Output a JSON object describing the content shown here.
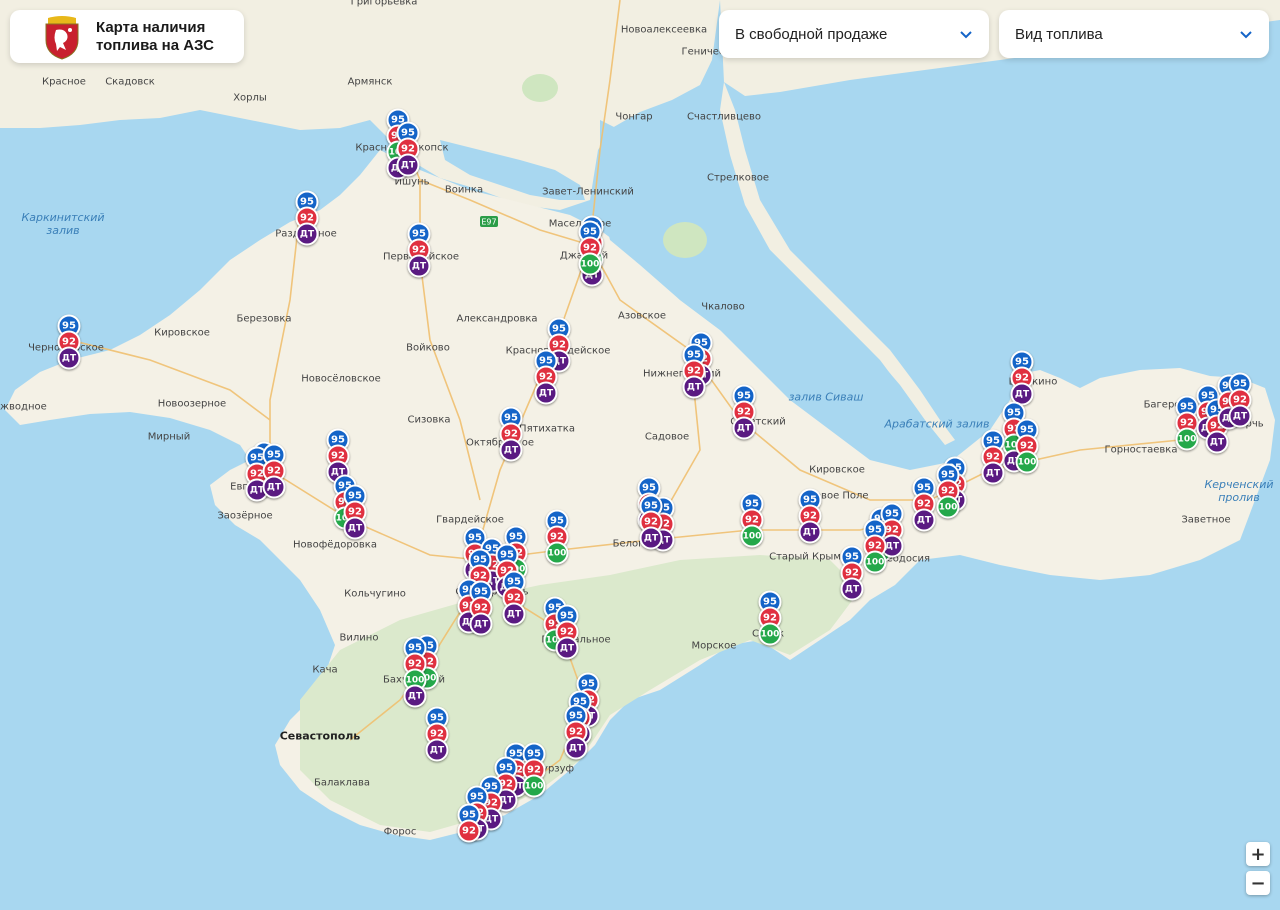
{
  "header": {
    "title_line1": "Карта наличия",
    "title_line2": "топлива на АЗС",
    "logo_icon": "crimea-coat-of-arms-icon"
  },
  "filters": {
    "sale_type": {
      "selected": "В свободной продаже"
    },
    "fuel_type": {
      "placeholder": "Вид топлива"
    }
  },
  "zoom": {
    "in_label": "+",
    "out_label": "−"
  },
  "colors": {
    "f95": "#1464c8",
    "f92": "#e03040",
    "fdt": "#5a1a82",
    "f100": "#24a84a",
    "sea": "#a8d7f0",
    "land": "#f4f1e6",
    "mountains": "#d8e8c8"
  },
  "fuel_labels": {
    "f95": "95",
    "f92": "92",
    "fdt": "ДТ",
    "f100": "100"
  },
  "places": [
    {
      "name": "Григорьевка"
    },
    {
      "name": "Новоалексеевка"
    },
    {
      "name": "Геническ"
    },
    {
      "name": "Красное"
    },
    {
      "name": "Скадовск"
    },
    {
      "name": "Хорлы"
    },
    {
      "name": "Армянск"
    },
    {
      "name": "Чонгар"
    },
    {
      "name": "Счастливцево"
    },
    {
      "name": "Красноперекопск"
    },
    {
      "name": "Ишунь"
    },
    {
      "name": "Воинка"
    },
    {
      "name": "Завет-Ленинский"
    },
    {
      "name": "Стрелковое"
    },
    {
      "name": "Раздольное"
    },
    {
      "name": "Первомайское"
    },
    {
      "name": "Масельское"
    },
    {
      "name": "Джанкой"
    },
    {
      "name": "Азовское"
    },
    {
      "name": "Чкалово"
    },
    {
      "name": "Березовка"
    },
    {
      "name": "Кировское"
    },
    {
      "name": "Александровка"
    },
    {
      "name": "Черноморское"
    },
    {
      "name": "Войково"
    },
    {
      "name": "Красногвардейское"
    },
    {
      "name": "Нижнегорский"
    },
    {
      "name": "Новосёловское"
    },
    {
      "name": "Новоозерное"
    },
    {
      "name": "Межводное"
    },
    {
      "name": "Сизовка"
    },
    {
      "name": "Пятихатка"
    },
    {
      "name": "Октябрьское"
    },
    {
      "name": "Садовое"
    },
    {
      "name": "Советский"
    },
    {
      "name": "Мирный"
    },
    {
      "name": "Евпатория"
    },
    {
      "name": "Заозёрное"
    },
    {
      "name": "Гвардейское"
    },
    {
      "name": "Новофёдоровка"
    },
    {
      "name": "Белогорск"
    },
    {
      "name": "Кировское"
    },
    {
      "name": "Новое Поле"
    },
    {
      "name": "Старый Крым"
    },
    {
      "name": "Кольчугино"
    },
    {
      "name": "Симферополь"
    },
    {
      "name": "Вилино"
    },
    {
      "name": "Кача"
    },
    {
      "name": "Бахчисарай"
    },
    {
      "name": "Перевальное"
    },
    {
      "name": "Морское"
    },
    {
      "name": "Судак"
    },
    {
      "name": "Севастополь"
    },
    {
      "name": "Балаклава"
    },
    {
      "name": "Гурзуф"
    },
    {
      "name": "Форос"
    },
    {
      "name": "Феодосия"
    },
    {
      "name": "Щёлкино"
    },
    {
      "name": "Багерово"
    },
    {
      "name": "Горностаевка"
    },
    {
      "name": "Заветное"
    },
    {
      "name": "Керчь"
    }
  ],
  "water_labels": [
    {
      "name": "Каркинитский залив"
    },
    {
      "name": "залив Сиваш"
    },
    {
      "name": "Арабатский залив"
    },
    {
      "name": "Керченский пролив"
    }
  ],
  "road_labels": [
    {
      "name": "E97"
    }
  ],
  "station_count": 67
}
